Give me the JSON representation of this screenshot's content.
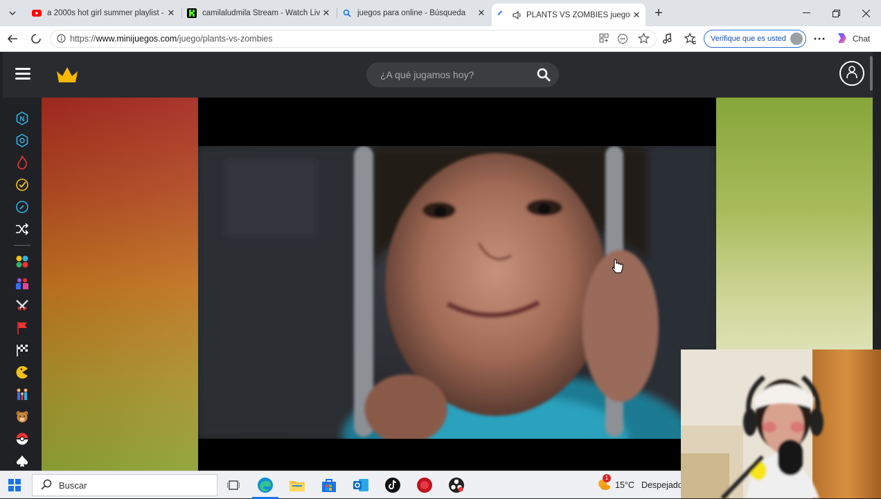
{
  "browser": {
    "tabs": [
      {
        "title": "a 2000s hot girl summer playlist -",
        "favicon": "youtube-icon",
        "active": false
      },
      {
        "title": "camilaludmila Stream - Watch Live",
        "favicon": "kick-icon",
        "active": false
      },
      {
        "title": "juegos para online - Búsqueda",
        "favicon": "search-icon",
        "active": false
      },
      {
        "title": "PLANTS VS ZOMBIES juego gratis",
        "favicon": "loading-icon",
        "active": true
      }
    ],
    "url_prefix": "https://",
    "url_host": "www.minijuegos.com",
    "url_path": "/juego/plants-vs-zombies",
    "verify_label": "Verifique que es usted",
    "chat_label": "Chat"
  },
  "site": {
    "search_placeholder": "¿A qué jugamos hoy?",
    "sidebar_icons": [
      "new-icon",
      "hex-icon",
      "fire-icon",
      "check-icon",
      "compass-icon",
      "shuffle-icon",
      "category-dots-icon",
      "multiplayer-icon",
      "swords-icon",
      "flag-icon",
      "racing-flag-icon",
      "pacman-icon",
      "family-icon",
      "bear-icon",
      "pokeball-icon",
      "spade-icon"
    ]
  },
  "taskbar": {
    "search_label": "Buscar",
    "temperature": "15°C",
    "weather": "Despejado",
    "notification_count": "1"
  },
  "colors": {
    "accent": "#0a5fcc",
    "site_bg": "#202124",
    "crown": "#f6b800"
  }
}
